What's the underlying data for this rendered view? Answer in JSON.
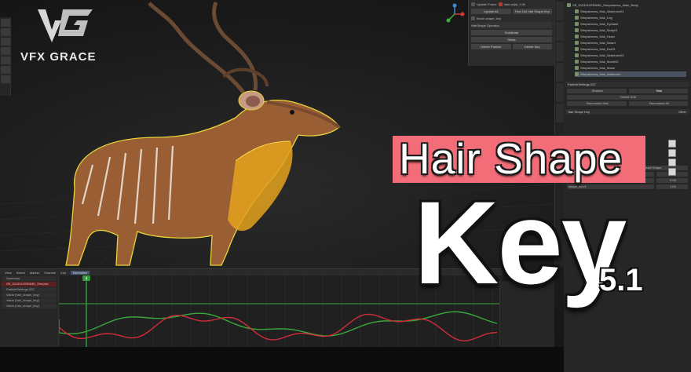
{
  "logo": {
    "text": "VFX GRACE"
  },
  "title": {
    "line1": "Hair Shape",
    "line2": "Key",
    "version": "5.1"
  },
  "ops_panel": {
    "update_frame": "Update Frame",
    "interval": "Interval(s)",
    "interval_value": "0.00",
    "update_all": "Update All",
    "find_old": "Find Old Hair Shape Key",
    "brush_shape": "Brush shape_key",
    "section": "HairShape Operator",
    "subdivide": "Subdivide",
    "relax": "Relax",
    "delete_particle": "Delete Particle",
    "delete_key": "Delete Key"
  },
  "outliner": {
    "header": "ZB_2023010SRAND_Strepsiceros_Male_Body",
    "items": [
      "Strepsiceros_Hair_Abdomen01",
      "Strepsiceros_Hair_Leg",
      "Strepsiceros_Hair_Eyelash",
      "Strepsiceros_Hair_Body01",
      "Strepsiceros_Hair_Head",
      "Strepsiceros_Hair_Beard",
      "Strepsiceros_Hair_Ear01",
      "Strepsiceros_Hair_Abdomen02",
      "Strepsiceros_Hair_Mane02",
      "Strepsiceros_Hair_Mane",
      "Strepsiceros_Hair_Abdomen"
    ]
  },
  "props_panel": {
    "particle_settings": "ParticleSettings.022",
    "unlink_label": "Shallow",
    "hair_label": "Hair",
    "delete_edit": "Delete Edit",
    "disconnect_hair": "Disconnect Hair",
    "disconnect_all": "Disconnect All",
    "hair_shape_key": "Hair Shape Key",
    "relative": "Relative",
    "display_data": "Display Data",
    "show_active": "Show Active Sha",
    "reset_shape": "Reset Shape",
    "other": "Other",
    "keys": [
      {
        "name": "shape_curv3",
        "value": "0.00"
      },
      {
        "name": "shape_curv2",
        "value": "0.93"
      },
      {
        "name": "shape_curv1",
        "value": "1.00"
      }
    ]
  },
  "timeline": {
    "menu": [
      "View",
      "Select",
      "Marker",
      "Channel",
      "Key",
      "Normalize"
    ],
    "current_frame": "4",
    "tracks": [
      "Summary",
      "ZB_2023010SRAND_Strepsic",
      "ParticleSettings.022",
      "Value (hair_shape_key)",
      "Value (hair_shape_key)",
      "Value (hair_shape_key)"
    ],
    "colors": {
      "red": "#d22c3a",
      "green": "#3aa83c",
      "playhead": "#2e9a3a"
    }
  }
}
